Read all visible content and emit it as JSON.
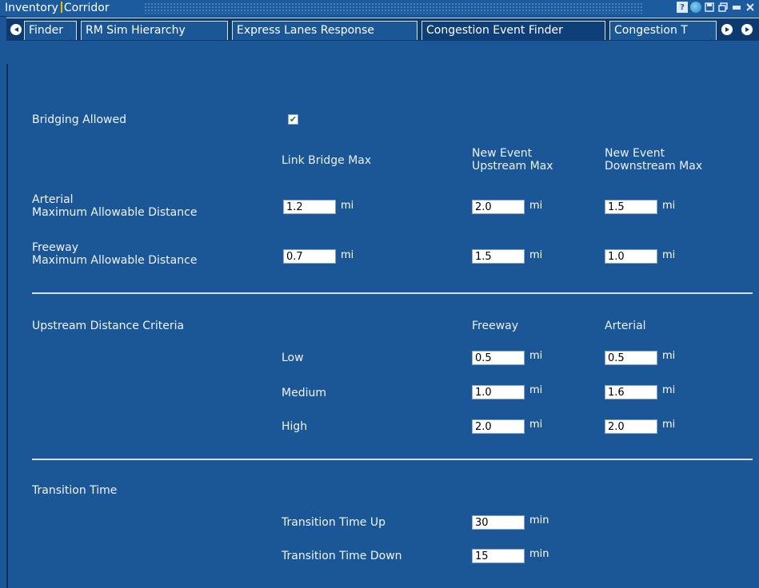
{
  "window": {
    "title_left": "Inventory",
    "title_right": "Corridor",
    "icons": [
      "help-icon",
      "globe-icon",
      "save-icon",
      "restore-icon",
      "minimize-icon",
      "close-icon"
    ]
  },
  "tabs": [
    {
      "label": "Finder",
      "active": false
    },
    {
      "label": "RM Sim Hierarchy",
      "active": false
    },
    {
      "label": "Express Lanes Response",
      "active": false
    },
    {
      "label": "Congestion Event Finder",
      "active": true
    },
    {
      "label": "Congestion T",
      "active": false
    }
  ],
  "bridging": {
    "label": "Bridging Allowed",
    "checked": true
  },
  "columns": {
    "link_bridge_max": "Link Bridge Max",
    "upstream_max_1": "New Event",
    "upstream_max_2": "Upstream Max",
    "downstream_max_1": "New Event",
    "downstream_max_2": "Downstream Max"
  },
  "arterial": {
    "label_1": "Arterial",
    "label_2": "Maximum Allowable Distance",
    "link_bridge": "1.2",
    "upstream": "2.0",
    "downstream": "1.5"
  },
  "freeway": {
    "label_1": "Freeway",
    "label_2": "Maximum Allowable Distance",
    "link_bridge": "0.7",
    "upstream": "1.5",
    "downstream": "1.0"
  },
  "upstream_criteria": {
    "label": "Upstream Distance Criteria",
    "col_freeway": "Freeway",
    "col_arterial": "Arterial",
    "rows": [
      {
        "label": "Low",
        "freeway": "0.5",
        "arterial": "0.5"
      },
      {
        "label": "Medium",
        "freeway": "1.0",
        "arterial": "1.6"
      },
      {
        "label": "High",
        "freeway": "2.0",
        "arterial": "2.0"
      }
    ]
  },
  "transition": {
    "label": "Transition Time",
    "up_label": "Transition Time Up",
    "up_value": "30",
    "down_label": "Transition Time Down",
    "down_value": "15",
    "unit": "min"
  },
  "unit_mi": "mi"
}
